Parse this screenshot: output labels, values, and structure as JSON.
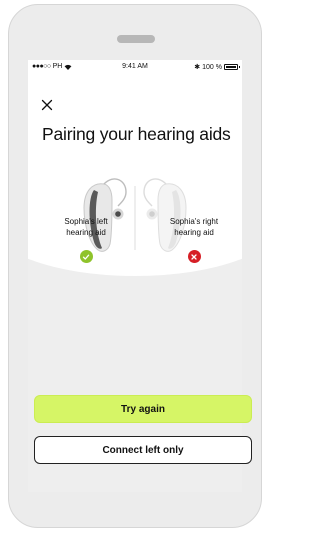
{
  "status_bar": {
    "carrier": "PH",
    "time": "9:41 AM",
    "battery": "100 %"
  },
  "header": {
    "title": "Pairing your hearing aids"
  },
  "devices": {
    "left": {
      "label_line1": "Sophia's left",
      "label_line2": "hearing aid",
      "status": "connected",
      "status_icon": "check-icon"
    },
    "right": {
      "label_line1": "Sophia's right",
      "label_line2": "hearing aid",
      "status": "failed",
      "status_icon": "x-icon"
    }
  },
  "actions": {
    "primary_label": "Try again",
    "secondary_label": "Connect left only"
  },
  "colors": {
    "accent": "#d6f566",
    "success": "#8fc32b",
    "error": "#d61f26"
  }
}
